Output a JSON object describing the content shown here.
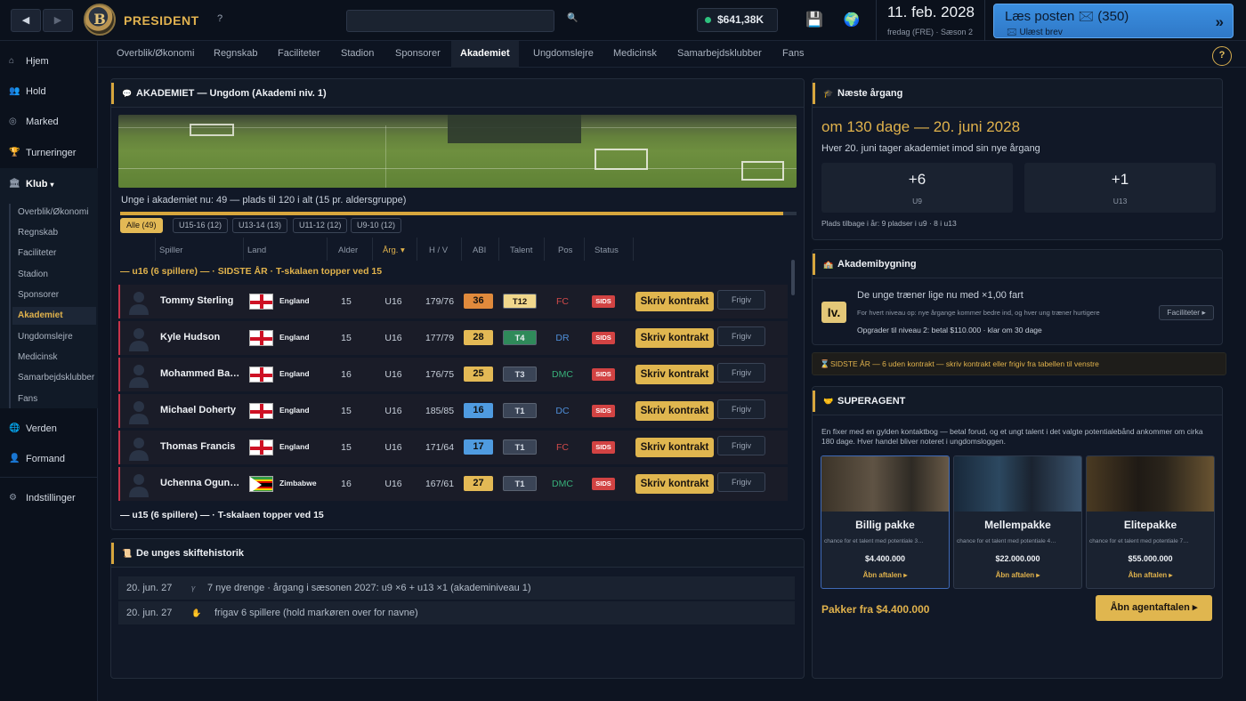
{
  "topbar": {
    "back": "◀",
    "forward": "▶",
    "brand": "PRESIDENT",
    "help": "?",
    "money": "$641,38K",
    "date": "11. feb. 2028",
    "date_sub": "fredag (FRE) · Sæson 2",
    "mail_title": "Læs posten 🖂 (350)",
    "mail_sub": "🖂 Ulæst brev",
    "mail_arrow": "»"
  },
  "sidebar": {
    "items": [
      {
        "label": "Hjem",
        "icon": "home-icon"
      },
      {
        "label": "Hold",
        "icon": "team-icon"
      },
      {
        "label": "Marked",
        "icon": "market-icon"
      },
      {
        "label": "Turneringer",
        "icon": "trophy-icon"
      },
      {
        "label": "Klub",
        "icon": "club-icon"
      },
      {
        "label": "Verden",
        "icon": "globe-icon"
      },
      {
        "label": "Formand",
        "icon": "person-icon"
      },
      {
        "label": "Indstillinger",
        "icon": "gear-icon"
      }
    ],
    "klub_caret": "▾",
    "sub": [
      "Overblik/Økonomi",
      "Regnskab",
      "Faciliteter",
      "Stadion",
      "Sponsorer",
      "Akademiet",
      "Ungdomslejre",
      "Medicinsk",
      "Samarbejdsklubber",
      "Fans"
    ]
  },
  "tabs": [
    "Overblik/Økonomi",
    "Regnskab",
    "Faciliteter",
    "Stadion",
    "Sponsorer",
    "Akademiet",
    "Ungdomslejre",
    "Medicinsk",
    "Samarbejdsklubber",
    "Fans"
  ],
  "help": "?",
  "academy": {
    "title": "AKADEMIET — Ungdom (Akademi niv. 1)",
    "capacity": "Unge i akademiet nu: 49 — plads til 120 i alt (15 pr. aldersgruppe)",
    "capacity_fraction": 0.98,
    "filters": [
      "Alle (49)",
      "U15-16 (12)",
      "U13-14 (13)",
      "U11-12 (12)",
      "U9-10 (12)"
    ],
    "columns": [
      "Spiller",
      "Land",
      "Alder",
      "Årg. ▾",
      "H / V",
      "ABI",
      "Talent",
      "Pos",
      "Status"
    ],
    "group1": "— u16 (6 spillere) — · SIDSTE ÅR · T-skalaen topper ved 15",
    "group2": "— u15 (6 spillere) — · T-skalaen topper ved 15",
    "contract_label": "Skriv kontrakt",
    "release_label": "Frigiv",
    "status_label": "SIDS",
    "players": [
      {
        "name": "Tommy Sterling",
        "country": "England",
        "flag": "england",
        "age": "15",
        "year": "U16",
        "hw": "179/76",
        "abi": "36",
        "abi_color": "#e08a3c",
        "talent": "T12",
        "talent_bg": "#f0d78c",
        "talent_fg": "#1a1410",
        "pos": "FC",
        "pos_color": "#d14a4a"
      },
      {
        "name": "Kyle Hudson",
        "country": "England",
        "flag": "england",
        "age": "15",
        "year": "U16",
        "hw": "177/79",
        "abi": "28",
        "abi_color": "#e3b955",
        "talent": "T4",
        "talent_bg": "#2f8a5a",
        "talent_fg": "#eef1f5",
        "pos": "DR",
        "pos_color": "#4f8fd9"
      },
      {
        "name": "Mohammed Ba…",
        "country": "England",
        "flag": "england",
        "age": "16",
        "year": "U16",
        "hw": "176/75",
        "abi": "25",
        "abi_color": "#e3b955",
        "talent": "T3",
        "talent_bg": "#3a4456",
        "talent_fg": "#d7dde6",
        "pos": "DMC",
        "pos_color": "#38b07a"
      },
      {
        "name": "Michael Doherty",
        "country": "England",
        "flag": "england",
        "age": "15",
        "year": "U16",
        "hw": "185/85",
        "abi": "16",
        "abi_color": "#4f9be0",
        "talent": "T1",
        "talent_bg": "#3a4456",
        "talent_fg": "#d7dde6",
        "pos": "DC",
        "pos_color": "#4f8fd9"
      },
      {
        "name": "Thomas Francis",
        "country": "England",
        "flag": "england",
        "age": "15",
        "year": "U16",
        "hw": "171/64",
        "abi": "17",
        "abi_color": "#4f9be0",
        "talent": "T1",
        "talent_bg": "#3a4456",
        "talent_fg": "#d7dde6",
        "pos": "FC",
        "pos_color": "#d14a4a"
      },
      {
        "name": "Uchenna Ogun…",
        "country": "Zimbabwe",
        "flag": "zimbabwe",
        "age": "16",
        "year": "U16",
        "hw": "167/61",
        "abi": "27",
        "abi_color": "#e3b955",
        "talent": "T1",
        "talent_bg": "#3a4456",
        "talent_fg": "#d7dde6",
        "pos": "DMC",
        "pos_color": "#38b07a"
      }
    ]
  },
  "history": {
    "title": "De unges skiftehistorik",
    "rows": [
      {
        "date": "20. jun. 27",
        "icon": "sprout-icon",
        "text": "7 nye drenge · årgang i sæsonen 2027: u9 ×6 + u13 ×1 (akademiniveau 1)"
      },
      {
        "date": "20. jun. 27",
        "icon": "hand-icon",
        "text": "frigav 6 spillere (hold markøren over for navne)"
      }
    ]
  },
  "next_intake": {
    "title": "Næste årgang",
    "when": "om 130 dage — 20. juni 2028",
    "sub": "Hver 20. juni tager akademiet imod sin nye årgang",
    "u9_value": "+6",
    "u9_label": "U9",
    "u13_value": "+1",
    "u13_label": "U13",
    "places_left": "Plads tilbage i år: 9 pladser i u9 · 8 i u13"
  },
  "building": {
    "title": "Akademibygning",
    "badge": "Iv.",
    "text": "De unge træner lige nu med ×1,00 fart",
    "sub": "For hvert niveau op: nye årgange kommer bedre ind, og hver ung træner hurtigere",
    "upgrade": "Opgrader til niveau 2: betal $110.000 · klar om 30 dage",
    "button": "Faciliteter ▸"
  },
  "warning": "SIDSTE ÅR — 6 uden kontrakt — skriv kontrakt eller frigiv fra tabellen til venstre",
  "superagent": {
    "title": "SUPERAGENT",
    "desc": "En fixer med en gylden kontaktbog — betal forud, og et ungt talent i det valgte potentialebånd ankommer om cirka 180 dage. Hver handel bliver noteret i ungdomsloggen.",
    "packages": [
      {
        "name": "Billig pakke",
        "chance": "chance for et talent med potentiale 3…",
        "price": "$4.400.000",
        "open": "Åbn aftalen ▸"
      },
      {
        "name": "Mellempakke",
        "chance": "chance for et talent med potentiale 4…",
        "price": "$22.000.000",
        "open": "Åbn aftalen ▸"
      },
      {
        "name": "Elitepakke",
        "chance": "chance for et talent med potentiale 7…",
        "price": "$55.000.000",
        "open": "Åbn aftalen ▸"
      }
    ],
    "from": "Pakker fra $4.400.000",
    "button": "Åbn agentaftalen ▸"
  }
}
